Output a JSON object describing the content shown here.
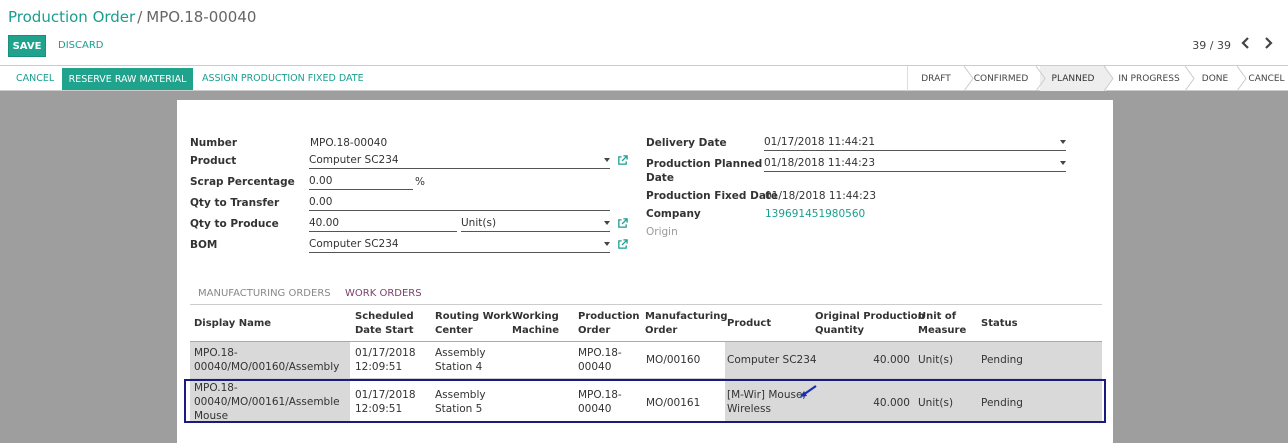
{
  "breadcrumb": {
    "parent": "Production Order",
    "sep": "/",
    "current": "MPO.18-00040"
  },
  "buttons": {
    "save": "SAVE",
    "discard": "DISCARD"
  },
  "pager": {
    "text": "39 / 39",
    "prev_icon": "chevron-left-icon",
    "next_icon": "chevron-right-icon"
  },
  "statusbar": {
    "cancel": "CANCEL",
    "reserve": "RESERVE RAW MATERIAL",
    "assign": "ASSIGN PRODUCTION FIXED DATE",
    "stages": [
      "DRAFT",
      "CONFIRMED",
      "PLANNED",
      "IN PROGRESS",
      "DONE",
      "CANCEL"
    ],
    "active_stage": "PLANNED"
  },
  "form": {
    "number_label": "Number",
    "number": "MPO.18-00040",
    "product_label": "Product",
    "product": "Computer SC234",
    "scrap_label": "Scrap Percentage",
    "scrap": "0.00",
    "scrap_unit": "%",
    "qty_transfer_label": "Qty to Transfer",
    "qty_transfer": "0.00",
    "qty_produce_label": "Qty to Produce",
    "qty_produce": "40.00",
    "uom": "Unit(s)",
    "bom_label": "BOM",
    "bom": "Computer SC234",
    "delivery_label": "Delivery Date",
    "delivery": "01/17/2018 11:44:21",
    "planned_label_1": "Production Planned",
    "planned_label_2": "Date",
    "planned": "01/18/2018 11:44:23",
    "fixed_label": "Production Fixed Date",
    "fixed": "01/18/2018 11:44:23",
    "company_label": "Company",
    "company": "139691451980560",
    "origin_label": "Origin"
  },
  "tabs": {
    "manufacturing": "MANUFACTURING ORDERS",
    "work": "WORK ORDERS"
  },
  "table": {
    "headers": {
      "display_name": "Display Name",
      "sched_1": "Scheduled",
      "sched_2": "Date Start",
      "routing_1": "Routing Work",
      "routing_2": "Center",
      "working_1": "Working",
      "working_2": "Machine",
      "prod_1": "Production",
      "prod_2": "Order",
      "mfg_1": "Manufacturing",
      "mfg_2": "Order",
      "product": "Product",
      "orig_1": "Original Production",
      "orig_2": "Quantity",
      "uom_1": "Unit of",
      "uom_2": "Measure",
      "status": "Status"
    },
    "rows": [
      {
        "name_1": "MPO.18-",
        "name_2": "00040/MO/00160/Assembly",
        "name_3": "",
        "sched_1": "01/17/2018",
        "sched_2": "12:09:51",
        "routing_1": "Assembly",
        "routing_2": "Station 4",
        "prod_1": "MPO.18-",
        "prod_2": "00040",
        "mfg": "MO/00160",
        "product_1": "Computer SC234",
        "product_2": "",
        "qty": "40.000",
        "uom": "Unit(s)",
        "status": "Pending"
      },
      {
        "name_1": "MPO.18-",
        "name_2": "00040/MO/00161/Assemble",
        "name_3": "Mouse",
        "sched_1": "01/17/2018",
        "sched_2": "12:09:51",
        "routing_1": "Assembly",
        "routing_2": "Station 5",
        "prod_1": "MPO.18-",
        "prod_2": "00040",
        "mfg": "MO/00161",
        "product_1": "[M-Wir] Mouse,",
        "product_2": "Wireless",
        "qty": "40.000",
        "uom": "Unit(s)",
        "status": "Pending"
      }
    ]
  },
  "colors": {
    "accent": "#1fa38c",
    "highlight_border": "#1a1a7f",
    "arrow": "#1a2fb0"
  }
}
